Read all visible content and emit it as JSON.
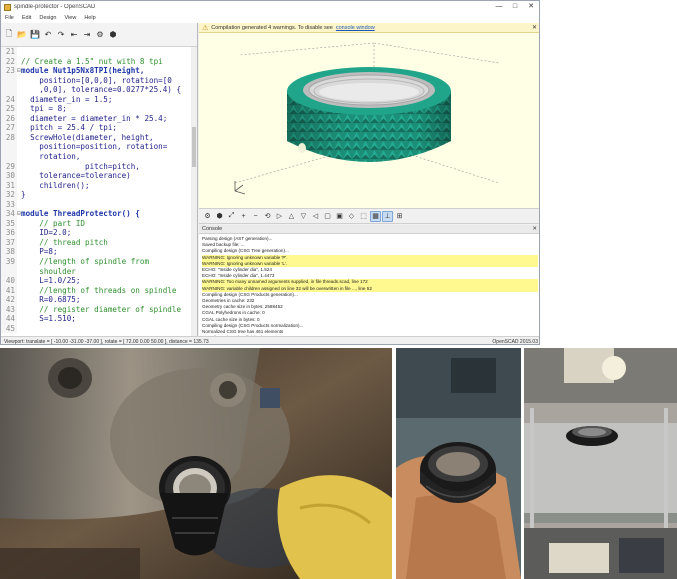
{
  "window": {
    "title": "spindle-protector - OpenSCAD",
    "minimize": "—",
    "maximize": "□",
    "close": "✕",
    "menu": [
      "File",
      "Edit",
      "Design",
      "View",
      "Help"
    ]
  },
  "editor_toolbar": {
    "icons": [
      "new-file-icon",
      "open-file-icon",
      "save-icon",
      "undo-icon",
      "redo-icon",
      "unindent-icon",
      "indent-icon",
      "preview-icon",
      "render-icon"
    ],
    "glyphs": [
      "🗋",
      "📂",
      "💾",
      "↶",
      "↷",
      "⇤",
      "⇥",
      "⚙",
      "⬢"
    ]
  },
  "editor": {
    "lines": [
      {
        "n": "21",
        "t": "",
        "c": "ct"
      },
      {
        "n": "22",
        "t": "// Create a 1.5\" nut with 8 tpi",
        "c": "ct cm"
      },
      {
        "n": "23",
        "t": "module Nut1p5Nx8TPI(height,",
        "c": "ct kw",
        "fold": "⊟"
      },
      {
        "n": "",
        "t": "    position=[0,0,0], rotation=[0",
        "c": "ct"
      },
      {
        "n": "",
        "t": "    ,0,0], tolerance=0.0277*25.4) {",
        "c": "ct"
      },
      {
        "n": "24",
        "t": "  diameter_in = 1.5;",
        "c": "ct"
      },
      {
        "n": "25",
        "t": "  tpi = 8;",
        "c": "ct"
      },
      {
        "n": "26",
        "t": "  diameter = diameter_in * 25.4;",
        "c": "ct"
      },
      {
        "n": "27",
        "t": "  pitch = 25.4 / tpi;",
        "c": "ct"
      },
      {
        "n": "28",
        "t": "  ScrewHole(diameter, height,",
        "c": "ct"
      },
      {
        "n": "",
        "t": "    position=position, rotation=",
        "c": "ct"
      },
      {
        "n": "",
        "t": "    rotation,",
        "c": "ct"
      },
      {
        "n": "29",
        "t": "              pitch=pitch,",
        "c": "ct"
      },
      {
        "n": "30",
        "t": "    tolerance=tolerance)",
        "c": "ct"
      },
      {
        "n": "31",
        "t": "    children();",
        "c": "ct"
      },
      {
        "n": "32",
        "t": "}",
        "c": "ct"
      },
      {
        "n": "33",
        "t": "",
        "c": "ct"
      },
      {
        "n": "34",
        "t": "module ThreadProtector() {",
        "c": "ct kw",
        "fold": "⊟"
      },
      {
        "n": "35",
        "t": "    // part ID",
        "c": "ct cm"
      },
      {
        "n": "36",
        "t": "    ID=2.0;",
        "c": "ct"
      },
      {
        "n": "37",
        "t": "    // thread pitch",
        "c": "ct cm"
      },
      {
        "n": "38",
        "t": "    P=8;",
        "c": "ct"
      },
      {
        "n": "39",
        "t": "    //length of spindle from",
        "c": "ct cm"
      },
      {
        "n": "",
        "t": "    shoulder",
        "c": "ct cm"
      },
      {
        "n": "40",
        "t": "    L=1.0/25;",
        "c": "ct"
      },
      {
        "n": "41",
        "t": "    //length of threads on spindle",
        "c": "ct cm"
      },
      {
        "n": "42",
        "t": "    R=0.6875;",
        "c": "ct"
      },
      {
        "n": "43",
        "t": "    // register diameter of spindle",
        "c": "ct cm"
      },
      {
        "n": "44",
        "t": "    S=1.510;",
        "c": "ct"
      },
      {
        "n": "45",
        "t": "",
        "c": "ct"
      }
    ]
  },
  "viewport": {
    "notice_text": "Compilation generated 4 warnings. To disable see",
    "notice_link": "console window",
    "notice_close": "✕",
    "model_color": "#1f9f86"
  },
  "view_toolbar": {
    "icons": [
      "preview-view-icon",
      "render-view-icon",
      "zoom-all-icon",
      "zoom-in-icon",
      "zoom-out-icon",
      "reset-view-icon",
      "view-right-icon",
      "view-top-icon",
      "view-bottom-icon",
      "view-left-icon",
      "view-front-icon",
      "view-back-icon",
      "view-diagonal-icon",
      "perspective-icon",
      "orthogonal-icon",
      "show-axes-icon",
      "show-edges-icon"
    ],
    "glyphs": [
      "⚙",
      "⬢",
      "⤢",
      "+",
      "−",
      "⟲",
      "▷",
      "△",
      "▽",
      "◁",
      "▢",
      "▣",
      "◇",
      "⬚",
      "▦",
      "⊥",
      "⊞"
    ],
    "active": [
      14,
      15
    ]
  },
  "console": {
    "title": "Console",
    "close": "✕",
    "lines": [
      {
        "t": "Parsing design (AST generation)...",
        "w": false
      },
      {
        "t": "Saved backup file: ...",
        "w": false
      },
      {
        "t": "Compiling design (CSG Tree generation)...",
        "w": false
      },
      {
        "t": "WARNING: Ignoring unknown variable 'P'.",
        "w": true
      },
      {
        "t": "WARNING: Ignoring unknown variable 'L'.",
        "w": true
      },
      {
        "t": "ECHO: \"Inside cylinder dia\", 1.524",
        "w": false
      },
      {
        "t": "ECHO: \"Inside cylinder dia\", 1.4473",
        "w": false
      },
      {
        "t": "WARNING: Too many unnamed arguments supplied, in file threads.scad, line 172",
        "w": true
      },
      {
        "t": "WARNING: variable children assigned on line 32 will be overwritten in file ..., line 52",
        "w": true
      },
      {
        "t": "Compiling design (CSG Products generation)...",
        "w": false
      },
      {
        "t": "Geometries in cache: 232",
        "w": false
      },
      {
        "t": "Geometry cache size in bytes: 2588452",
        "w": false
      },
      {
        "t": "CGAL Polyhedrons in cache: 0",
        "w": false
      },
      {
        "t": "CGAL cache size in bytes: 0",
        "w": false
      },
      {
        "t": "Compiling design (CSG Products normalization)...",
        "w": false
      },
      {
        "t": "Normalized CSG tree has 461 elements",
        "w": false
      },
      {
        "t": "Compile and preview finished.",
        "w": false
      },
      {
        "t": "Total rendering time: 0 hours, 0 minutes, 2 seconds",
        "w": false
      }
    ]
  },
  "statusbar": {
    "text": "Viewport: translate = [ -10.00 -31.00 -37.00 ], rotate = [ 72.00 0.00 50.00 ], distance = 135.73",
    "version": "OpenSCAD 2015.03"
  }
}
